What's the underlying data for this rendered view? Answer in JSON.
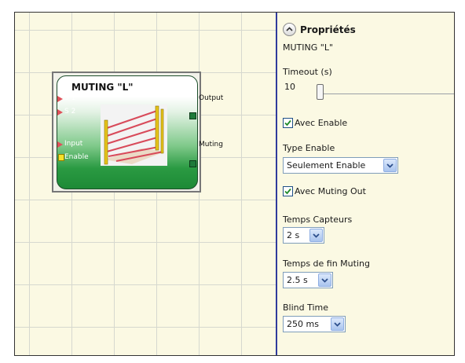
{
  "block": {
    "title": "MUTING \"L\"",
    "inputs": [
      {
        "label": "S 1"
      },
      {
        "label": "S 2"
      },
      {
        "label": "Input"
      }
    ],
    "enable_label": "Enable",
    "outputs": [
      {
        "label": "Output"
      },
      {
        "label": "Muting"
      }
    ]
  },
  "panel": {
    "header_title": "Propriétés",
    "block_name": "MUTING \"L\"",
    "timeout": {
      "label": "Timeout (s)",
      "value": "10"
    },
    "avec_enable": {
      "label": "Avec Enable",
      "checked": true
    },
    "type_enable": {
      "label": "Type Enable",
      "value": "Seulement Enable"
    },
    "avec_muting_out": {
      "label": "Avec Muting Out",
      "checked": true
    },
    "temps_capteurs": {
      "label": "Temps Capteurs",
      "value": "2 s"
    },
    "temps_fin_muting": {
      "label": "Temps de fin Muting",
      "value": "2.5 s"
    },
    "blind_time": {
      "label": "Blind Time",
      "value": "250 ms"
    }
  },
  "colors": {
    "divider": "#2f3b9c",
    "canvas_background": "#fbf9e3",
    "block_green": "#2a9a42",
    "input_pin": "#e0505a",
    "enable_pin": "#f5e12a",
    "output_pin": "#1e7a3a"
  },
  "icons": [
    "chevron-up-icon",
    "checkmark-icon",
    "dropdown-arrow-icon",
    "muting-light-curtain-icon"
  ]
}
